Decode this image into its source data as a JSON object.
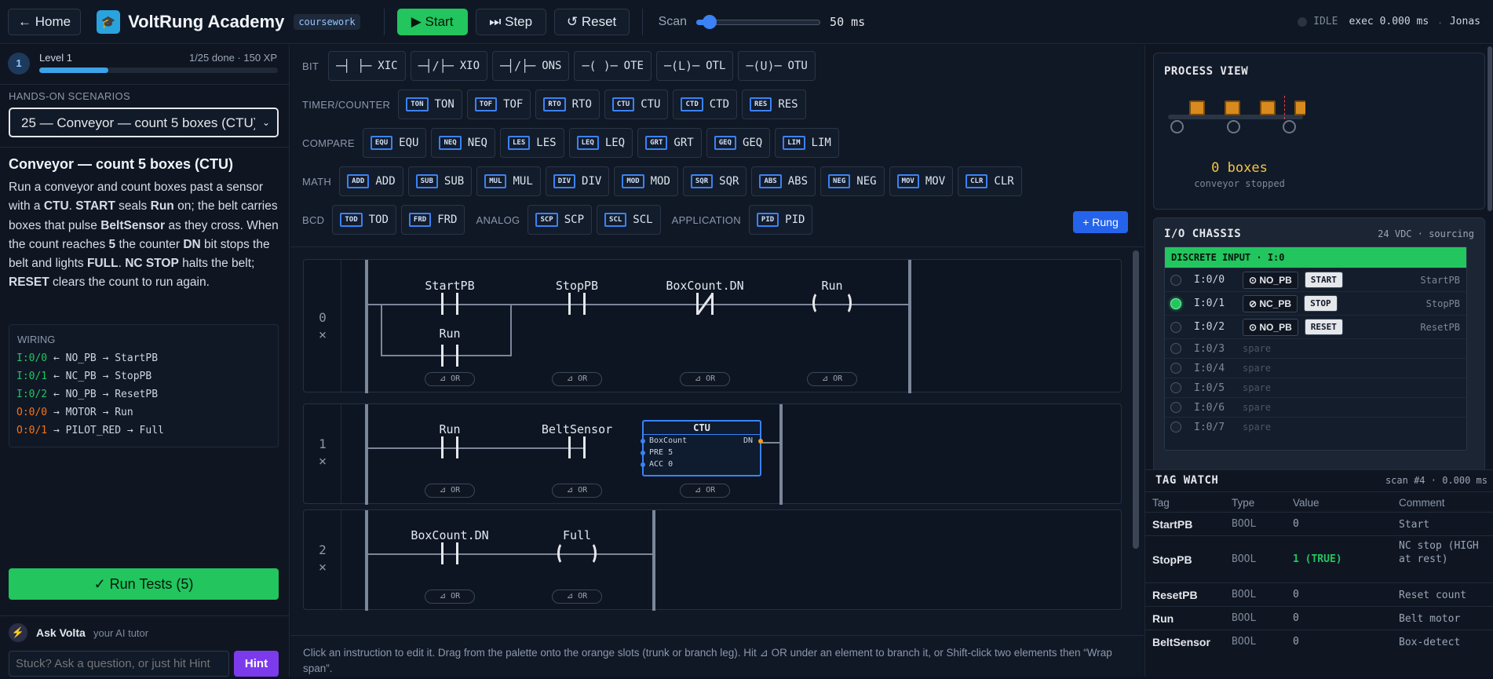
{
  "topbar": {
    "home_label": "← Home",
    "app_title": "VoltRung Academy",
    "badge": "coursework",
    "start_label": "▶ Start",
    "step_label": "⏭ Step",
    "reset_label": "↺ Reset",
    "scan_label": "Scan",
    "scan_value_label": "50 ms",
    "scan_value": 50,
    "status": "IDLE",
    "exec": "exec 0.000 ms",
    "user": "Jonas"
  },
  "level": {
    "number": "1",
    "label": "Level 1",
    "progress_text": "1/25 done · 150 XP",
    "progress_fraction": 0.29
  },
  "scenarios": {
    "heading": "HANDS-ON SCENARIOS",
    "selected": "25 — Conveyor — count 5 boxes (CTU)"
  },
  "scenario": {
    "title": "Conveyor — count 5 boxes (CTU)"
  },
  "wiring": {
    "heading": "WIRING",
    "rows": [
      {
        "addr": "I:0/0",
        "rest": " ← NO_PB → StartPB"
      },
      {
        "addr": "I:0/1",
        "rest": " ← NC_PB → StopPB"
      },
      {
        "addr": "I:0/2",
        "rest": " ← NO_PB → ResetPB"
      },
      {
        "addr": "O:0/0",
        "rest": " → MOTOR → Run"
      },
      {
        "addr": "O:0/1",
        "rest": " → PILOT_RED → Full"
      }
    ]
  },
  "run_tests_label": "✓ Run Tests (5)",
  "tutor": {
    "name": "Ask Volta",
    "sub": "your AI tutor",
    "placeholder": "Stuck? Ask a question, or just hit Hint",
    "hint_label": "Hint"
  },
  "palette": {
    "bit_label": "BIT",
    "timer_label": "TIMER/COUNTER",
    "compare_label": "COMPARE",
    "math_label": "MATH",
    "bcd_label": "BCD",
    "analog_label": "ANALOG",
    "application_label": "APPLICATION",
    "add_rung_label": "+ Rung",
    "bit": [
      {
        "sym": "─┤ ├─",
        "name": "XIC"
      },
      {
        "sym": "─┤/├─",
        "name": "XIO"
      },
      {
        "sym": "─┤/├─",
        "name": "ONS"
      },
      {
        "sym": "─( )─",
        "name": "OTE"
      },
      {
        "sym": "─(L)─",
        "name": "OTL"
      },
      {
        "sym": "─(U)─",
        "name": "OTU"
      }
    ],
    "timer": [
      {
        "ic": "TON",
        "name": "TON"
      },
      {
        "ic": "TOF",
        "name": "TOF"
      },
      {
        "ic": "RTO",
        "name": "RTO"
      },
      {
        "ic": "CTU",
        "name": "CTU"
      },
      {
        "ic": "CTD",
        "name": "CTD"
      },
      {
        "ic": "RES",
        "name": "RES"
      }
    ],
    "compare": [
      {
        "ic": "EQU",
        "name": "EQU"
      },
      {
        "ic": "NEQ",
        "name": "NEQ"
      },
      {
        "ic": "LES",
        "name": "LES"
      },
      {
        "ic": "LEQ",
        "name": "LEQ"
      },
      {
        "ic": "GRT",
        "name": "GRT"
      },
      {
        "ic": "GEQ",
        "name": "GEQ"
      },
      {
        "ic": "LIM",
        "name": "LIM"
      }
    ],
    "math": [
      {
        "ic": "ADD",
        "name": "ADD"
      },
      {
        "ic": "SUB",
        "name": "SUB"
      },
      {
        "ic": "MUL",
        "name": "MUL"
      },
      {
        "ic": "DIV",
        "name": "DIV"
      },
      {
        "ic": "MOD",
        "name": "MOD"
      },
      {
        "ic": "SQR",
        "name": "SQR"
      },
      {
        "ic": "ABS",
        "name": "ABS"
      },
      {
        "ic": "NEG",
        "name": "NEG"
      },
      {
        "ic": "MOV",
        "name": "MOV"
      },
      {
        "ic": "CLR",
        "name": "CLR"
      }
    ],
    "bcd": [
      {
        "ic": "TOD",
        "name": "TOD"
      },
      {
        "ic": "FRD",
        "name": "FRD"
      }
    ],
    "analog": [
      {
        "ic": "SCP",
        "name": "SCP"
      },
      {
        "ic": "SCL",
        "name": "SCL"
      }
    ],
    "application": [
      {
        "ic": "PID",
        "name": "PID"
      }
    ]
  },
  "rungs": {
    "r0": {
      "num": "0",
      "del": "×",
      "startpb": "StartPB",
      "stoppb": "StopPB",
      "boxdn": "BoxCount.DN",
      "run": "Run",
      "branch_run": "Run"
    },
    "r1": {
      "num": "1",
      "del": "×",
      "run": "Run",
      "belt": "BeltSensor",
      "ctu_title": "CTU",
      "ctu_tag": "BoxCount",
      "ctu_pre": "PRE 5",
      "ctu_acc": "ACC 0",
      "ctu_dn": "DN"
    },
    "r2": {
      "num": "2",
      "del": "×",
      "boxdn": "BoxCount.DN",
      "full": "Full"
    },
    "or_label": "⊿ OR"
  },
  "footer_hint": "Click an instruction to edit it. Drag from the palette onto the orange slots (trunk or branch leg). Hit ⊿ OR under an element to branch it, or Shift-click two elements then “Wrap span”.",
  "process": {
    "title": "PROCESS VIEW",
    "boxes": "0 boxes",
    "status": "conveyor stopped"
  },
  "chassis": {
    "title": "I/O CHASSIS",
    "spec": "24 VDC · sourcing",
    "module": "DISCRETE INPUT · I:0",
    "rows": [
      {
        "addr": "I:0/0",
        "type": "⊙ NO_PB",
        "button": "START",
        "tag": "StartPB",
        "on": false
      },
      {
        "addr": "I:0/1",
        "type": "⊘ NC_PB",
        "button": "STOP",
        "tag": "StopPB",
        "on": true
      },
      {
        "addr": "I:0/2",
        "type": "⊙ NO_PB",
        "button": "RESET",
        "tag": "ResetPB",
        "on": false
      },
      {
        "addr": "I:0/3",
        "type": "spare",
        "button": "",
        "tag": "",
        "on": false
      },
      {
        "addr": "I:0/4",
        "type": "spare",
        "button": "",
        "tag": "",
        "on": false
      },
      {
        "addr": "I:0/5",
        "type": "spare",
        "button": "",
        "tag": "",
        "on": false
      },
      {
        "addr": "I:0/6",
        "type": "spare",
        "button": "",
        "tag": "",
        "on": false
      },
      {
        "addr": "I:0/7",
        "type": "spare",
        "button": "",
        "tag": "",
        "on": false
      }
    ]
  },
  "tagwatch": {
    "title": "TAG WATCH",
    "info": "scan #4 · 0.000 ms",
    "headers": [
      "Tag",
      "Type",
      "Value",
      "Comment"
    ],
    "rows": [
      {
        "tag": "StartPB",
        "type": "BOOL",
        "value": "0",
        "comment": "Start"
      },
      {
        "tag": "StopPB",
        "type": "BOOL",
        "value": "1 (TRUE)",
        "comment": "NC stop (HIGH at rest)"
      },
      {
        "tag": "ResetPB",
        "type": "BOOL",
        "value": "0",
        "comment": "Reset count"
      },
      {
        "tag": "Run",
        "type": "BOOL",
        "value": "0",
        "comment": "Belt motor"
      },
      {
        "tag": "BeltSensor",
        "type": "BOOL",
        "value": "0",
        "comment": "Box-detect"
      }
    ]
  },
  "colors": {
    "accent": "#22c55e",
    "blue": "#3b82f6",
    "orange": "#f97316",
    "box": "#d98a1e"
  }
}
